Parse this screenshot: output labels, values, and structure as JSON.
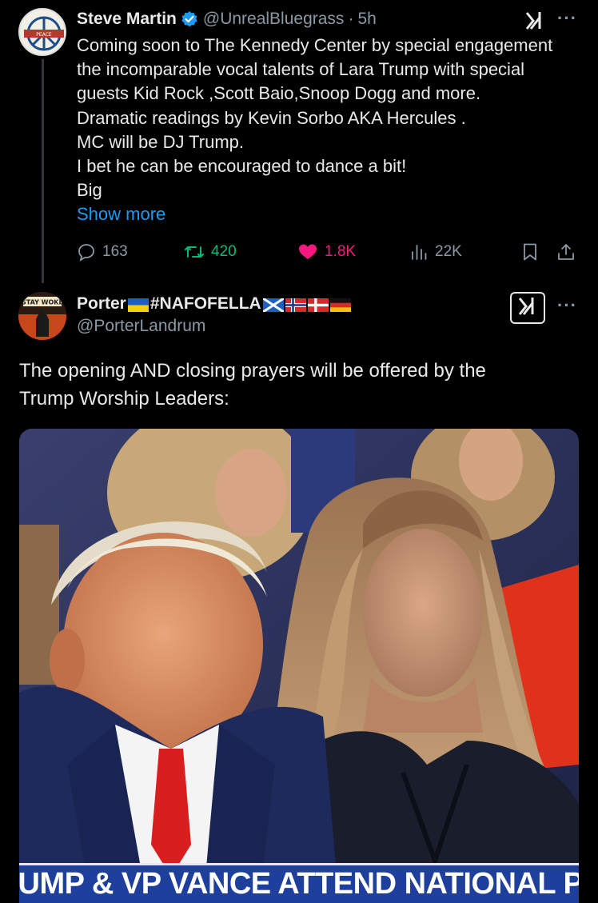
{
  "tweet1": {
    "display_name": "Steve Martin",
    "handle": "@UnrealBluegrass",
    "separator": "·",
    "time": "5h",
    "body_lines": [
      "Coming soon to The Kennedy  Center by special engagement",
      "the incomparable vocal talents of Lara Trump with special",
      "guests Kid Rock ,Scott Baio,Snoop Dogg and more.",
      "Dramatic readings by Kevin Sorbo AKA Hercules .",
      "MC will be DJ Trump.",
      "I bet he can be encouraged to dance a bit!",
      "Big"
    ],
    "show_more": "Show more",
    "replies": "163",
    "reposts": "420",
    "likes": "1.8K",
    "views": "22K",
    "avatar_text": "PEACE"
  },
  "tweet2": {
    "display_name": "Porter",
    "hashtag": "#NAFOFELLA",
    "handle": "@PorterLandrum",
    "avatar_text": "STAY WOKE",
    "body_lines": [
      "The opening AND closing prayers will be offered by the",
      "Trump Worship Leaders:"
    ],
    "media_caption": "'UMP & VP VANCE ATTEND NATIONAL P"
  },
  "colors": {
    "background": "#000000",
    "text": "#e7e9ea",
    "secondary": "#8b98a5",
    "link": "#1d9bf0",
    "repost": "#00ba7c",
    "like": "#f91880",
    "verified": "#1d9bf0"
  },
  "icons": {
    "reply": "reply-icon",
    "repost": "repost-icon",
    "like": "heart-icon",
    "views": "views-icon",
    "bookmark": "bookmark-icon",
    "share": "share-icon",
    "grok": "grok-icon",
    "more": "more-icon"
  }
}
